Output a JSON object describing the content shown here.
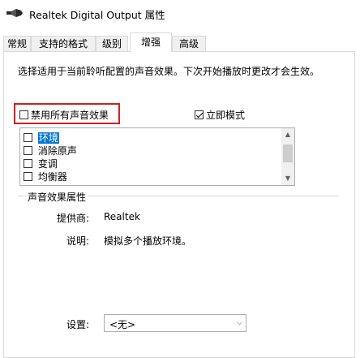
{
  "window": {
    "title": "Realtek Digital Output 属性"
  },
  "tabs": [
    {
      "label": "常规",
      "active": false
    },
    {
      "label": "支持的格式",
      "active": false
    },
    {
      "label": "级别",
      "active": false
    },
    {
      "label": "增强",
      "active": true
    },
    {
      "label": "高级",
      "active": false
    }
  ],
  "enhance": {
    "description": "选择适用于当前聆听配置的声音效果。下次开始播放时更改才会生效。",
    "disable_all_label": "禁用所有声音效果",
    "disable_all_checked": false,
    "immediate_label": "立即模式",
    "immediate_checked": true,
    "effects": [
      {
        "label": "环境",
        "checked": false,
        "selected": true
      },
      {
        "label": "消除原声",
        "checked": false,
        "selected": false
      },
      {
        "label": "变调",
        "checked": false,
        "selected": false
      },
      {
        "label": "均衡器",
        "checked": false,
        "selected": false
      }
    ]
  },
  "properties": {
    "group_title": "声音效果属性",
    "provider_label": "提供商:",
    "provider_value": "Realtek",
    "description_label": "说明:",
    "description_value": "模拟多个播放环境。",
    "setting_label": "设置:",
    "setting_value": "<无>"
  },
  "icons": {
    "speaker": "speaker-icon",
    "dropdown": "chevron-down-icon",
    "scroll_up": "scroll-up-icon",
    "scroll_down": "scroll-down-icon"
  },
  "colors": {
    "selection": "#0078d7",
    "highlight_border": "#d02020"
  }
}
